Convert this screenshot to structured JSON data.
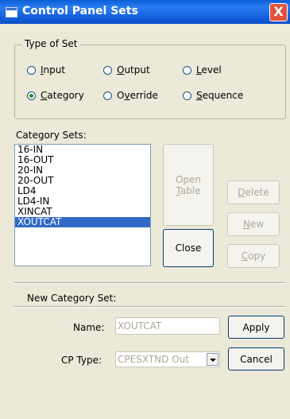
{
  "window": {
    "title": "Control Panel Sets",
    "close_label": "X"
  },
  "type_of_set": {
    "legend": "Type of Set",
    "options": [
      {
        "pre": "",
        "accel": "I",
        "post": "nput",
        "selected": false
      },
      {
        "pre": "",
        "accel": "O",
        "post": "utput",
        "selected": false
      },
      {
        "pre": "",
        "accel": "L",
        "post": "evel",
        "selected": false
      },
      {
        "pre": "",
        "accel": "C",
        "post": "ategory",
        "selected": true
      },
      {
        "pre": "O",
        "accel": "v",
        "post": "erride",
        "selected": false
      },
      {
        "pre": "",
        "accel": "S",
        "post": "equence",
        "selected": false
      }
    ]
  },
  "category_sets": {
    "label": "Category Sets:",
    "items": [
      "16-IN",
      "16-OUT",
      "20-IN",
      "20-OUT",
      "LD4",
      "LD4-IN",
      "XINCAT",
      "XOUTCAT"
    ],
    "selected_index": 7
  },
  "buttons": {
    "open_table_line1": "Open",
    "open_table_accel": "T",
    "open_table_line2_rest": "able",
    "close": "Close",
    "delete_accel": "D",
    "delete_rest": "elete",
    "new_accel": "N",
    "new_rest": "ew",
    "copy_accel": "C",
    "copy_rest": "opy",
    "apply": "Apply",
    "cancel": "Cancel"
  },
  "new_set": {
    "heading": "New Category Set:",
    "name_label": "Name:",
    "name_value": "XOUTCAT",
    "cp_type_label": "CP Type:",
    "cp_type_value": "CPESXTND Out"
  },
  "colors": {
    "title_bar": "#1560e0",
    "selection": "#316ac5",
    "dialog_bg": "#ece9d8",
    "close_button": "#e3523b"
  }
}
